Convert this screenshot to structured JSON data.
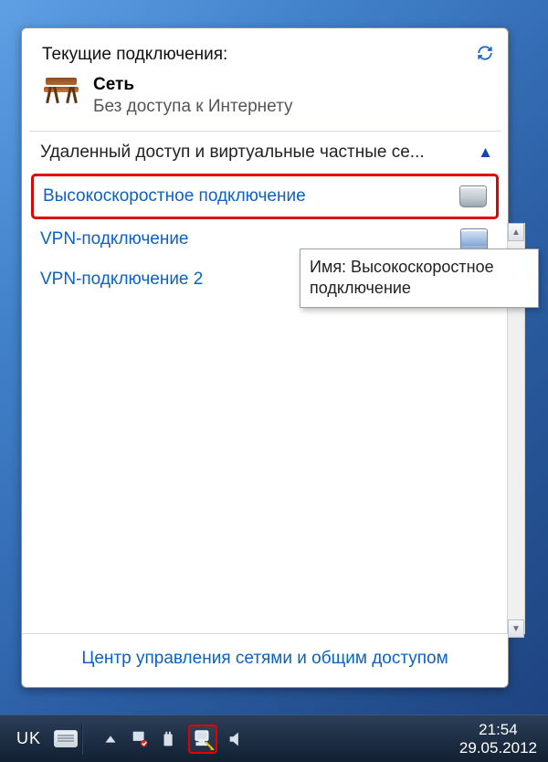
{
  "flyout": {
    "title": "Текущие подключения:",
    "network": {
      "name": "Сеть",
      "status": "Без доступа к Интернету"
    },
    "section_header": "Удаленный доступ и виртуальные частные се...",
    "connections": [
      {
        "label": "Высокоскоростное подключение",
        "icon": "modem",
        "highlight": true
      },
      {
        "label": "VPN-подключение",
        "icon": "server",
        "highlight": false
      },
      {
        "label": "VPN-подключение 2",
        "icon": "server",
        "highlight": false
      }
    ],
    "footer_link": "Центр управления сетями и общим доступом"
  },
  "tooltip": {
    "line1": "Имя: Высокоскоростное",
    "line2": "подключение"
  },
  "taskbar": {
    "lang": "UK",
    "time": "21:54",
    "date": "29.05.2012"
  }
}
